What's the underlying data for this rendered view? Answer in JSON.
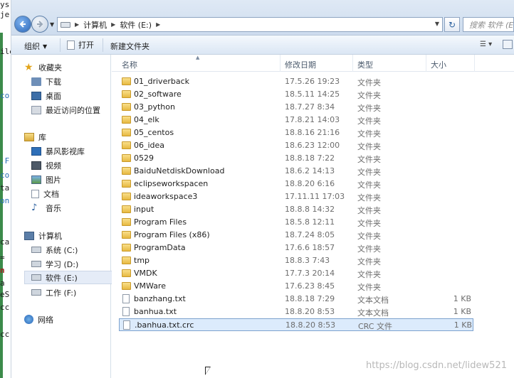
{
  "background_window": {
    "fragments": [
      "ys",
      "je",
      "ile",
      "co",
      ".F",
      "co",
      "ta",
      "on",
      "ca",
      "=",
      "n",
      "a",
      "eS",
      "cc",
      "cc"
    ]
  },
  "address": {
    "segments": [
      "计算机",
      "软件 (E:)"
    ],
    "search_placeholder": "搜索 软件 (E:)"
  },
  "toolbar": {
    "organize_label": "组织",
    "open_label": "打开",
    "new_folder_label": "新建文件夹"
  },
  "nav": {
    "favorites": {
      "label": "收藏夹",
      "items": [
        "下载",
        "桌面",
        "最近访问的位置"
      ]
    },
    "libraries": {
      "label": "库",
      "items": [
        "暴风影视库",
        "视频",
        "图片",
        "文档",
        "音乐"
      ]
    },
    "computer": {
      "label": "计算机",
      "items": [
        "系统 (C:)",
        "学习 (D:)",
        "软件 (E:)",
        "工作 (F:)"
      ],
      "selected_index": 2
    },
    "network": {
      "label": "网络"
    }
  },
  "columns": {
    "name": "名称",
    "date": "修改日期",
    "type": "类型",
    "size": "大小"
  },
  "files": [
    {
      "name": "01_driverback",
      "date": "17.5.26 19:23",
      "type": "文件夹",
      "size": "",
      "kind": "folder"
    },
    {
      "name": "02_software",
      "date": "18.5.11 14:25",
      "type": "文件夹",
      "size": "",
      "kind": "folder"
    },
    {
      "name": "03_python",
      "date": "18.7.27 8:34",
      "type": "文件夹",
      "size": "",
      "kind": "folder"
    },
    {
      "name": "04_elk",
      "date": "17.8.21 14:03",
      "type": "文件夹",
      "size": "",
      "kind": "folder"
    },
    {
      "name": "05_centos",
      "date": "18.8.16 21:16",
      "type": "文件夹",
      "size": "",
      "kind": "folder"
    },
    {
      "name": "06_idea",
      "date": "18.6.23 12:00",
      "type": "文件夹",
      "size": "",
      "kind": "folder"
    },
    {
      "name": "0529",
      "date": "18.8.18 7:22",
      "type": "文件夹",
      "size": "",
      "kind": "folder"
    },
    {
      "name": "BaiduNetdiskDownload",
      "date": "18.6.2 14:13",
      "type": "文件夹",
      "size": "",
      "kind": "folder"
    },
    {
      "name": "eclipseworkspacen",
      "date": "18.8.20 6:16",
      "type": "文件夹",
      "size": "",
      "kind": "folder"
    },
    {
      "name": "ideaworkspace3",
      "date": "17.11.11 17:03",
      "type": "文件夹",
      "size": "",
      "kind": "folder"
    },
    {
      "name": "input",
      "date": "18.8.8 14:32",
      "type": "文件夹",
      "size": "",
      "kind": "folder"
    },
    {
      "name": "Program Files",
      "date": "18.5.8 12:11",
      "type": "文件夹",
      "size": "",
      "kind": "folder"
    },
    {
      "name": "Program Files (x86)",
      "date": "18.7.24 8:05",
      "type": "文件夹",
      "size": "",
      "kind": "folder"
    },
    {
      "name": "ProgramData",
      "date": "17.6.6 18:57",
      "type": "文件夹",
      "size": "",
      "kind": "folder"
    },
    {
      "name": "tmp",
      "date": "18.8.3 7:43",
      "type": "文件夹",
      "size": "",
      "kind": "folder"
    },
    {
      "name": "VMDK",
      "date": "17.7.3 20:14",
      "type": "文件夹",
      "size": "",
      "kind": "folder"
    },
    {
      "name": "VMWare",
      "date": "17.6.23 8:45",
      "type": "文件夹",
      "size": "",
      "kind": "folder"
    },
    {
      "name": "banzhang.txt",
      "date": "18.8.18 7:29",
      "type": "文本文档",
      "size": "1 KB",
      "kind": "txt"
    },
    {
      "name": "banhua.txt",
      "date": "18.8.20 8:53",
      "type": "文本文档",
      "size": "1 KB",
      "kind": "txt"
    },
    {
      "name": ".banhua.txt.crc",
      "date": "18.8.20 8:53",
      "type": "CRC 文件",
      "size": "1 KB",
      "kind": "crc"
    }
  ],
  "selected_file_index": 19,
  "watermark": "https://blog.csdn.net/lidew521",
  "colors": {
    "selection_fill": "#dcebfc",
    "selection_border": "#7da2ce",
    "folder": "#e7b941",
    "address_bar": "#dfe9f5"
  }
}
